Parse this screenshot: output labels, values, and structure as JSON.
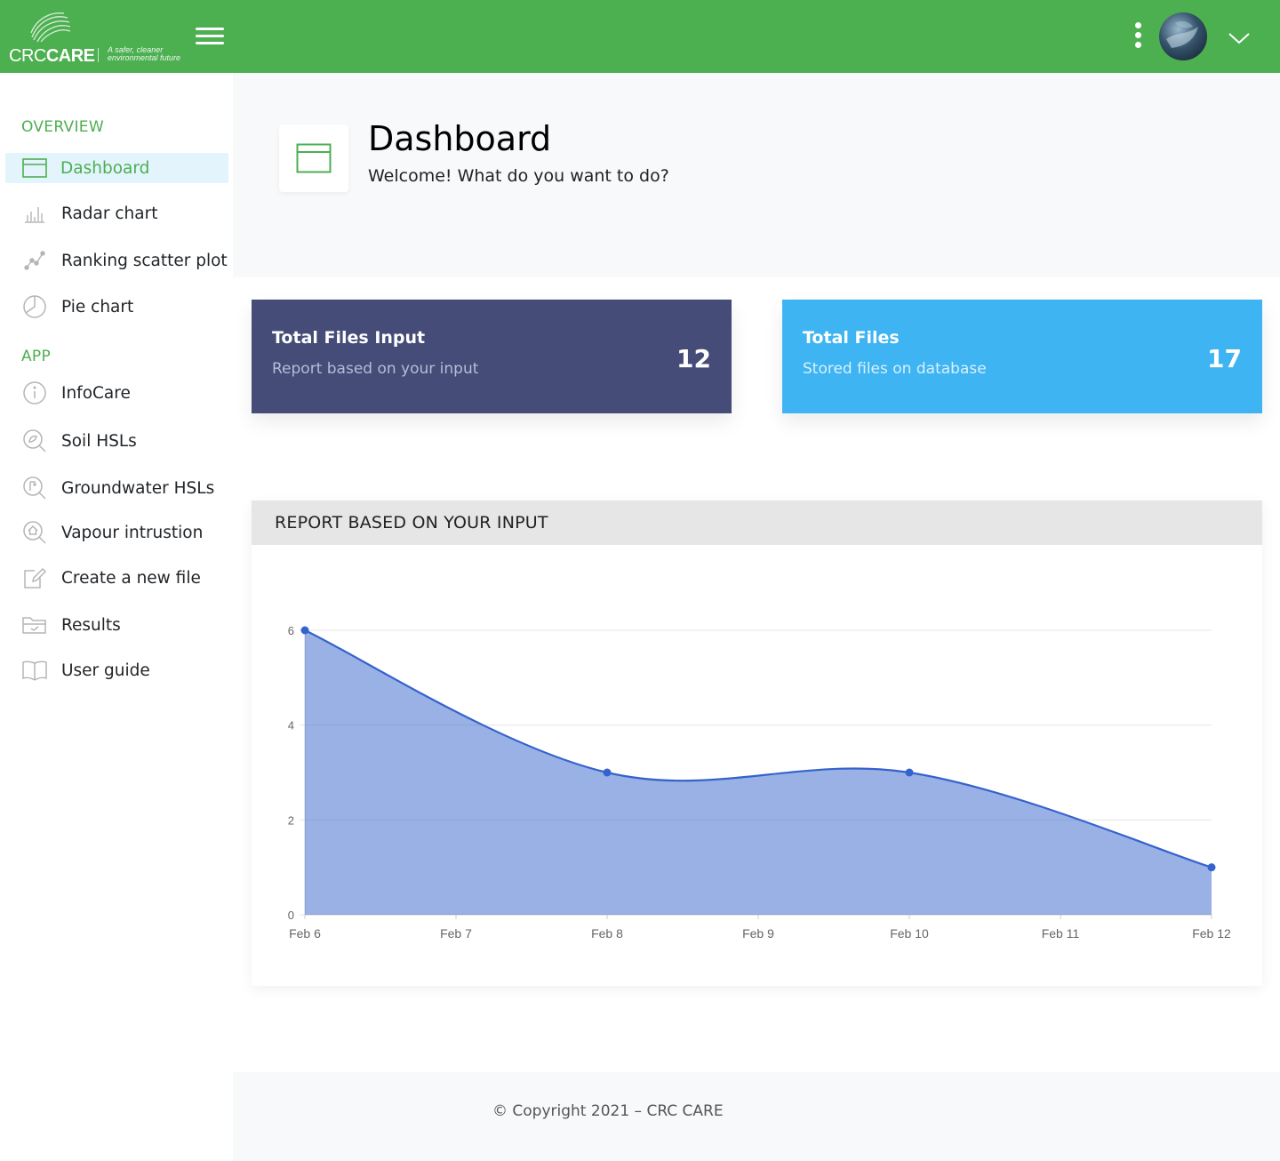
{
  "header": {
    "logo_word_light": "CRC",
    "logo_word_bold": "CARE",
    "logo_tagline": "A safer, cleaner environmental future",
    "menu_icon": "hamburger-icon",
    "more_icon": "kebab-icon",
    "dropdown_icon": "chevron-down-icon",
    "color": "#4caf50"
  },
  "sidebar": {
    "overview_label": "OVERVIEW",
    "app_label": "APP",
    "overview_items": [
      {
        "label": "Dashboard",
        "icon": "dashboard-icon",
        "active": true
      },
      {
        "label": "Radar chart",
        "icon": "bar-chart-icon"
      },
      {
        "label": "Ranking scatter plot",
        "icon": "scatter-icon"
      },
      {
        "label": "Pie chart",
        "icon": "pie-chart-icon"
      }
    ],
    "app_items": [
      {
        "label": "InfoCare",
        "icon": "info-icon"
      },
      {
        "label": "Soil HSLs",
        "icon": "search-soil-icon"
      },
      {
        "label": "Groundwater HSLs",
        "icon": "groundwater-icon"
      },
      {
        "label": "Vapour intrustion",
        "icon": "vapour-icon"
      },
      {
        "label": "Create a new file",
        "icon": "edit-icon"
      },
      {
        "label": "Results",
        "icon": "folder-icon"
      },
      {
        "label": "User guide",
        "icon": "book-icon"
      }
    ]
  },
  "page": {
    "title": "Dashboard",
    "subtitle": "Welcome! What do you want to do?",
    "icon": "dashboard-icon"
  },
  "cards": [
    {
      "title": "Total Files Input",
      "subtitle": "Report based on your input",
      "value": "12",
      "color": "#444c77"
    },
    {
      "title": "Total Files",
      "subtitle": "Stored files on database",
      "value": "17",
      "color": "#3eb4f2"
    }
  ],
  "panel": {
    "title": "REPORT BASED ON YOUR INPUT"
  },
  "chart_data": {
    "type": "area",
    "x": [
      "Feb 6",
      "Feb 7",
      "Feb 8",
      "Feb 9",
      "Feb 10",
      "Feb 11",
      "Feb 12"
    ],
    "series": [
      {
        "values": [
          6,
          null,
          3,
          null,
          3,
          null,
          1
        ],
        "color": "#3563cc"
      }
    ],
    "yticks": [
      0,
      2,
      4,
      6
    ],
    "ylim": [
      0,
      6
    ],
    "grid": true,
    "legend": "none"
  },
  "footer": {
    "text": "© Copyright 2021 – CRC CARE"
  }
}
